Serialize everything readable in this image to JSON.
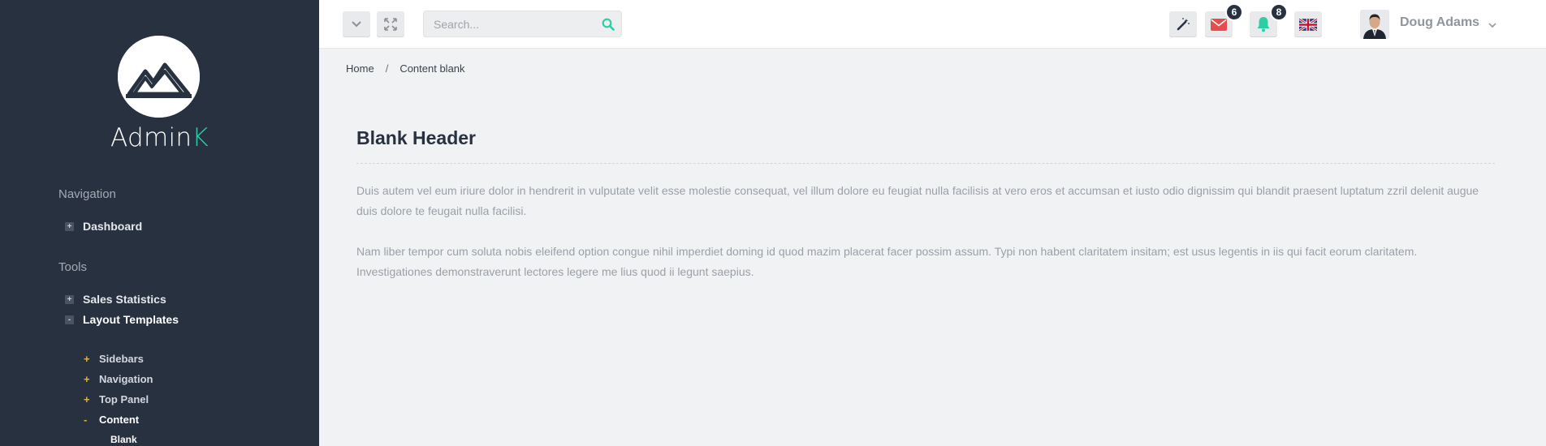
{
  "app": {
    "brand_main": "Admin",
    "brand_accent": "K"
  },
  "sidebar": {
    "sections": [
      {
        "title": "Navigation"
      },
      {
        "title": "Tools"
      }
    ],
    "items": [
      {
        "label": "Dashboard",
        "sign": "+"
      },
      {
        "label": "Sales Statistics",
        "sign": "+"
      },
      {
        "label": "Layout Templates",
        "sign": "-"
      }
    ],
    "sub_items": [
      {
        "label": "Sidebars",
        "sign": "+"
      },
      {
        "label": "Navigation",
        "sign": "+"
      },
      {
        "label": "Top Panel",
        "sign": "+"
      },
      {
        "label": "Content",
        "sign": "-"
      }
    ],
    "sub_sub_items": [
      {
        "label": "Blank"
      }
    ]
  },
  "topbar": {
    "search_placeholder": "Search...",
    "mail_count": "6",
    "notification_count": "8",
    "user_name": "Doug Adams"
  },
  "breadcrumb": {
    "home": "Home",
    "separator": "/",
    "current": "Content blank"
  },
  "content": {
    "title": "Blank Header",
    "paragraphs": [
      "Duis autem vel eum iriure dolor in hendrerit in vulputate velit esse molestie consequat, vel illum dolore eu feugiat nulla facilisis at vero eros et accumsan et iusto odio dignissim qui blandit praesent luptatum zzril delenit augue duis dolore te feugait nulla facilisi.",
      "Nam liber tempor cum soluta nobis eleifend option congue nihil imperdiet doming id quod mazim placerat facer possim assum. Typi non habent claritatem insitam; est usus legentis in iis qui facit eorum claritatem. Investigationes demonstraverunt lectores legere me lius quod ii legunt saepius."
    ]
  },
  "colors": {
    "sidebar_bg": "#283140",
    "accent": "#2dcea6",
    "mail": "#e74c4c",
    "bell": "#2dcea6",
    "tree_sign": "#e3b341"
  },
  "icons": {
    "collapse": "chevron-down-icon",
    "fullscreen": "fullscreen-icon",
    "search": "search-icon",
    "wand": "magic-wand-icon",
    "mail": "envelope-icon",
    "bell": "bell-icon",
    "language": "uk-flag-icon"
  }
}
